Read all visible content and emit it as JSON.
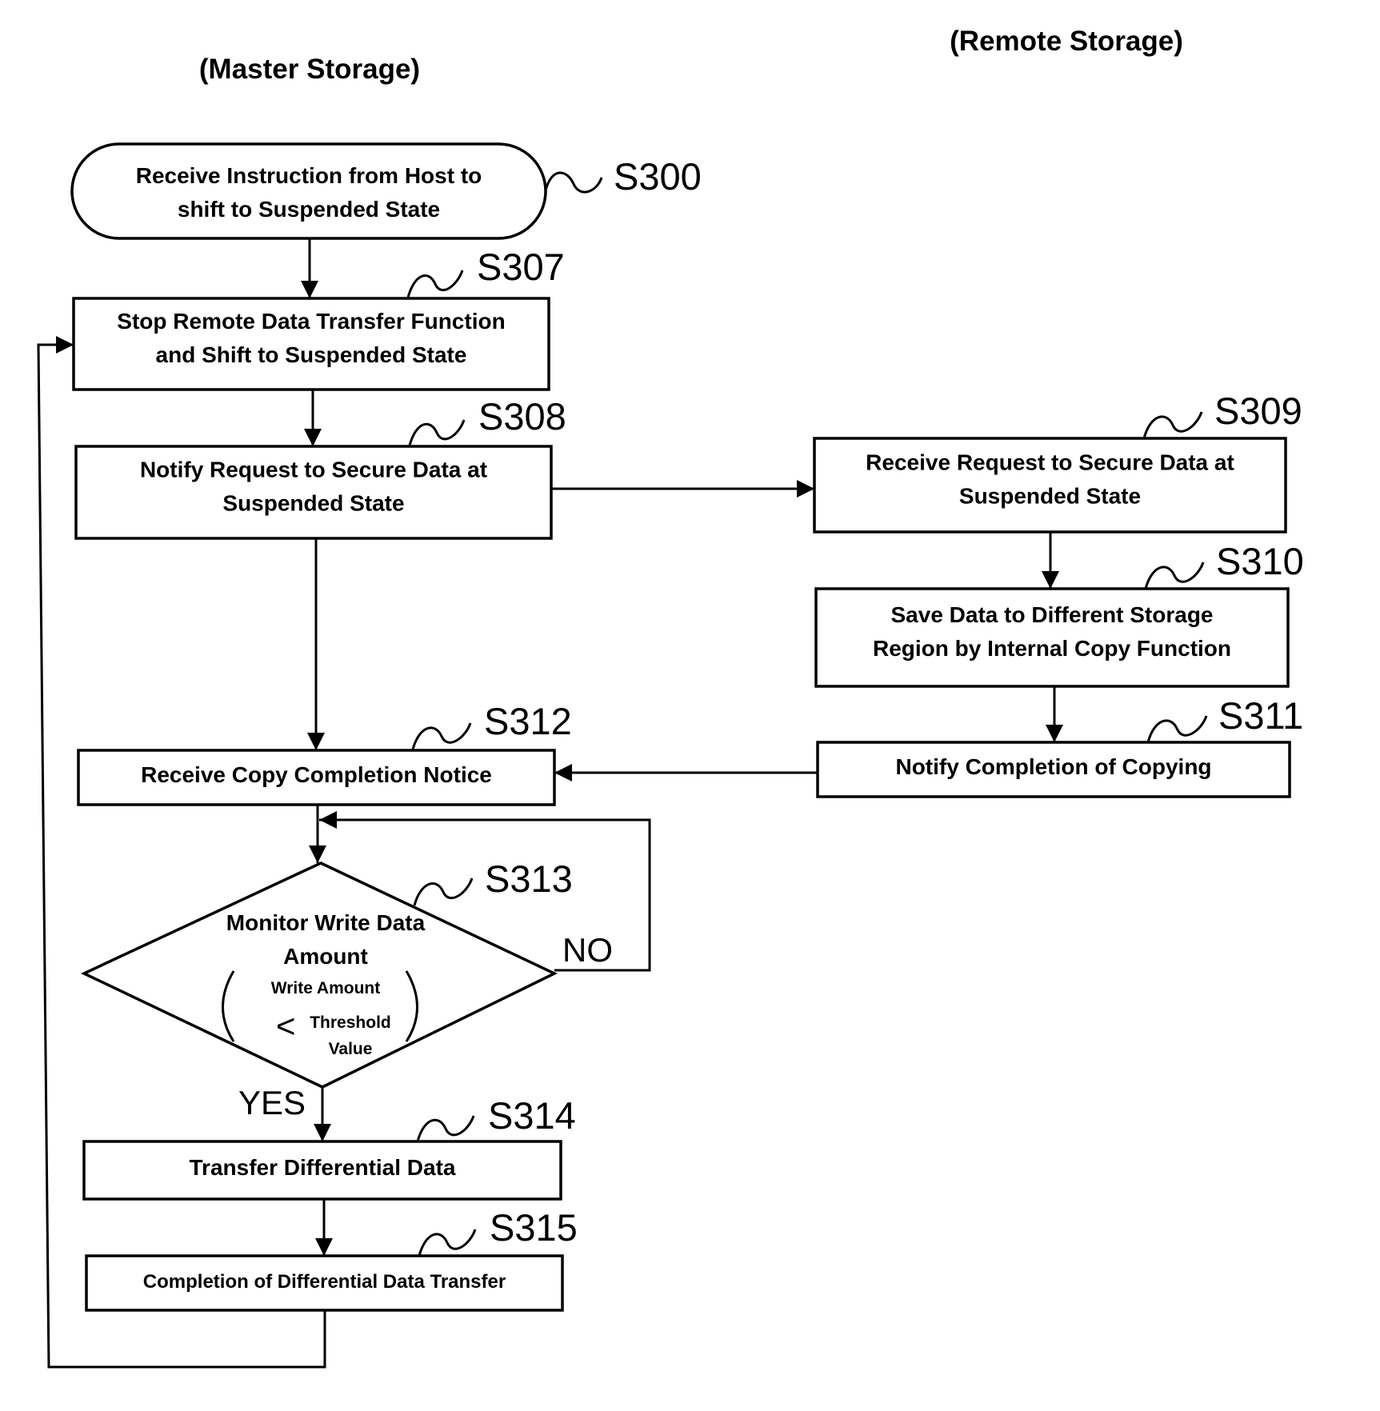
{
  "lanes": {
    "master": "(Master Storage)",
    "remote": "(Remote Storage)"
  },
  "steps": {
    "S300": {
      "id": "S300",
      "type": "terminal",
      "lines": [
        "Receive Instruction from Host to",
        "shift to Suspended State"
      ]
    },
    "S307": {
      "id": "S307",
      "type": "process",
      "lines": [
        "Stop Remote Data Transfer Function",
        "and Shift to Suspended State"
      ]
    },
    "S308": {
      "id": "S308",
      "type": "process",
      "lines": [
        "Notify Request to Secure Data at",
        "Suspended State"
      ]
    },
    "S309": {
      "id": "S309",
      "type": "process",
      "lines": [
        "Receive Request to Secure Data at",
        "Suspended State"
      ]
    },
    "S310": {
      "id": "S310",
      "type": "process",
      "lines": [
        "Save Data to Different Storage",
        "Region by Internal Copy Function"
      ]
    },
    "S311": {
      "id": "S311",
      "type": "process",
      "lines": [
        "Notify Completion of Copying"
      ]
    },
    "S312": {
      "id": "S312",
      "type": "process",
      "lines": [
        "Receive Copy Completion Notice"
      ]
    },
    "S313": {
      "id": "S313",
      "type": "decision",
      "lines": [
        "Monitor Write Data",
        "Amount"
      ],
      "condition": {
        "left": "Write Amount",
        "operator": "<",
        "right_line1": "Threshold",
        "right_line2": "Value"
      },
      "yes_label": "YES",
      "no_label": "NO"
    },
    "S314": {
      "id": "S314",
      "type": "process",
      "lines": [
        "Transfer Differential Data"
      ]
    },
    "S315": {
      "id": "S315",
      "type": "process",
      "lines": [
        "Completion of Differential Data Transfer"
      ]
    }
  },
  "edges": [
    {
      "from": "S300",
      "to": "S307"
    },
    {
      "from": "S307",
      "to": "S308"
    },
    {
      "from": "S308",
      "to": "S309"
    },
    {
      "from": "S308",
      "to": "S312"
    },
    {
      "from": "S309",
      "to": "S310"
    },
    {
      "from": "S310",
      "to": "S311"
    },
    {
      "from": "S311",
      "to": "S312"
    },
    {
      "from": "S312",
      "to": "S313"
    },
    {
      "from": "S313",
      "to": "S313",
      "label": "NO"
    },
    {
      "from": "S313",
      "to": "S314",
      "label": "YES"
    },
    {
      "from": "S314",
      "to": "S315"
    },
    {
      "from": "S315",
      "to": "S307"
    }
  ]
}
